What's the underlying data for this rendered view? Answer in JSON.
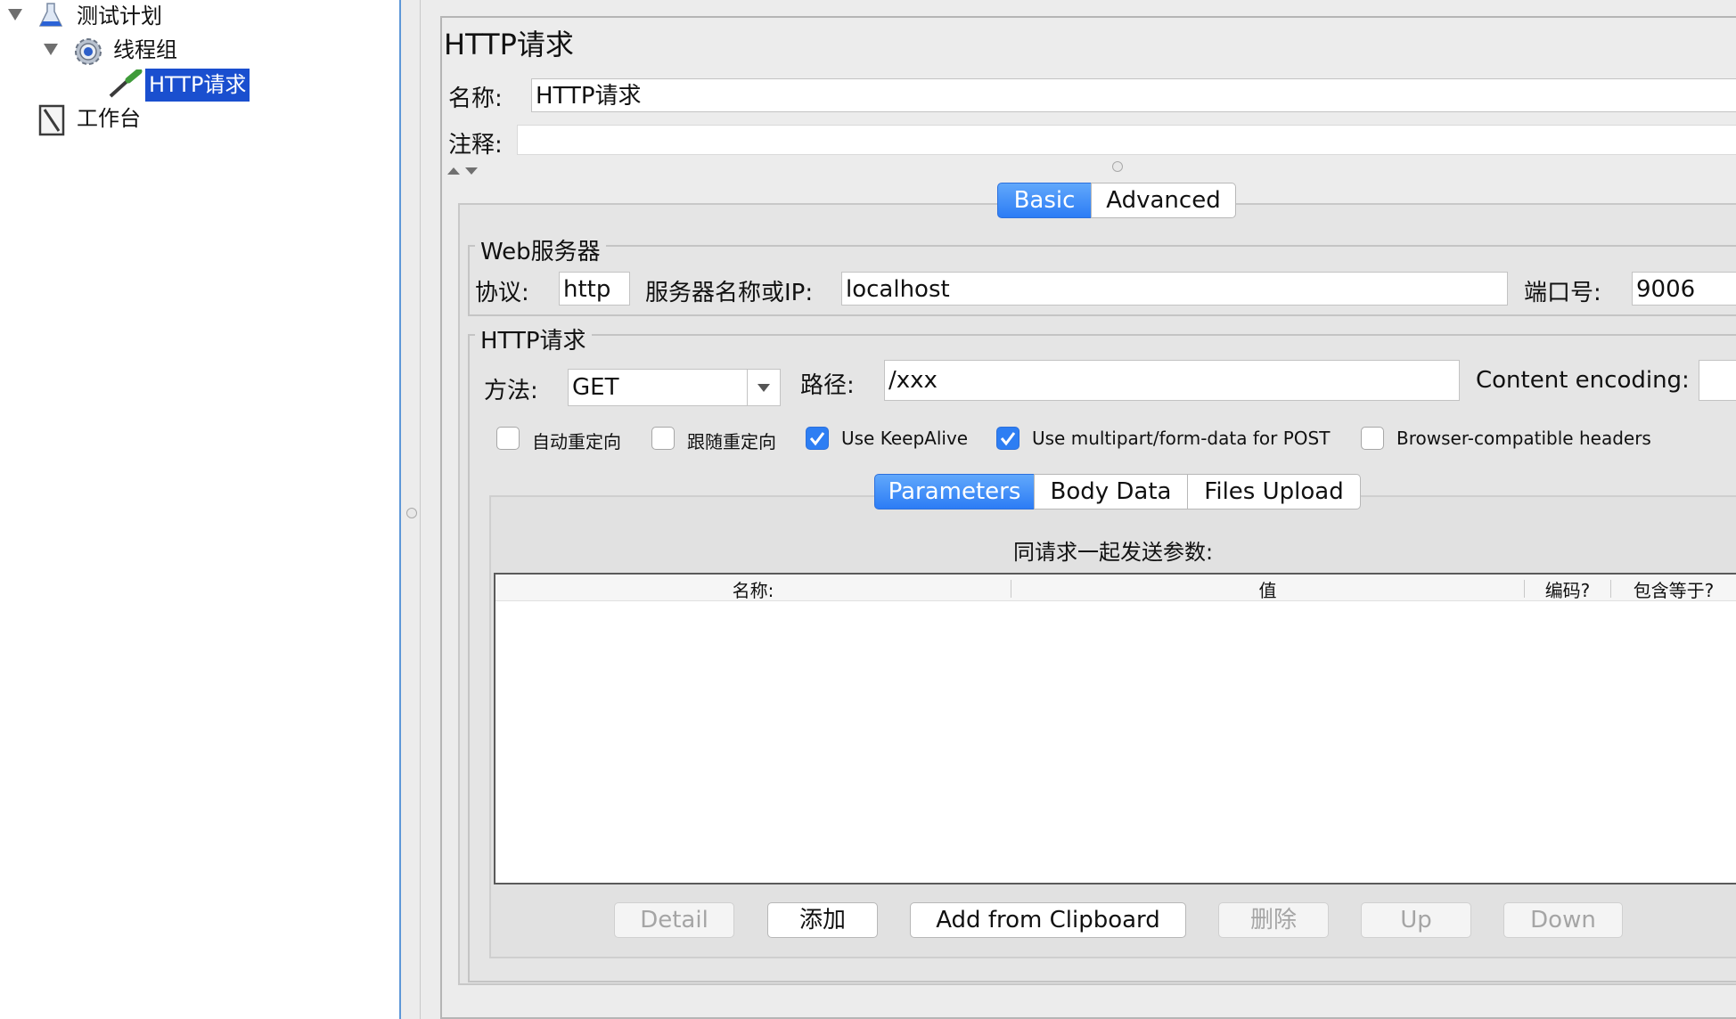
{
  "tree": {
    "items": [
      {
        "label": "测试计划",
        "icon": "flask-icon"
      },
      {
        "label": "线程组",
        "icon": "gear-icon"
      },
      {
        "label": "HTTP请求",
        "icon": "pipette-icon"
      },
      {
        "label": "工作台",
        "icon": "workbench-icon"
      }
    ]
  },
  "panel": {
    "title": "HTTP请求",
    "name_label": "名称:",
    "name_value": "HTTP请求",
    "comment_label": "注释:",
    "comment_value": ""
  },
  "tabs": {
    "items": [
      "Basic",
      "Advanced"
    ],
    "active": "Basic"
  },
  "web_server": {
    "legend": "Web服务器",
    "protocol_label": "协议:",
    "protocol_value": "http",
    "server_label": "服务器名称或IP:",
    "server_value": "localhost",
    "port_label": "端口号:",
    "port_value": "9006"
  },
  "http_request": {
    "legend": "HTTP请求",
    "method_label": "方法:",
    "method_value": "GET",
    "path_label": "路径:",
    "path_value": "/xxx",
    "encoding_label": "Content encoding:",
    "encoding_value": ""
  },
  "checkboxes": [
    {
      "label": "自动重定向",
      "checked": false
    },
    {
      "label": "跟随重定向",
      "checked": false
    },
    {
      "label": "Use KeepAlive",
      "checked": true
    },
    {
      "label": "Use multipart/form-data for POST",
      "checked": true
    },
    {
      "label": "Browser-compatible headers",
      "checked": false
    }
  ],
  "subtabs": {
    "items": [
      "Parameters",
      "Body Data",
      "Files Upload"
    ],
    "active": "Parameters"
  },
  "params": {
    "caption": "同请求一起发送参数:",
    "columns": [
      "名称:",
      "值",
      "编码?",
      "包含等于?"
    ]
  },
  "buttons": {
    "detail": "Detail",
    "add": "添加",
    "add_clipboard": "Add from Clipboard",
    "delete": "删除",
    "up": "Up",
    "down": "Down"
  },
  "colors": {
    "selection": "#1a4fcf",
    "accent": "#2d7ef3"
  }
}
